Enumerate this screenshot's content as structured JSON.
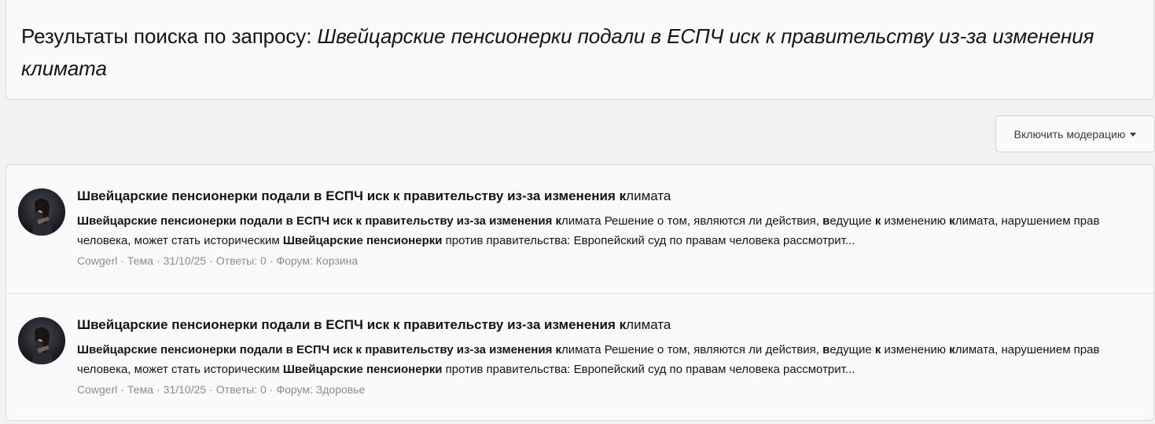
{
  "header": {
    "title_prefix": "Результаты поиска по запросу: ",
    "query": "Швейцарские пенсионерки подали в ЕСПЧ иск к правительству из-за изменения климата"
  },
  "toolbar": {
    "moderation_label": "Включить модерацию"
  },
  "results": [
    {
      "avatar": "user-avatar",
      "title_bold": "Швейцарские пенсионерки подали в ЕСПЧ иск к правительству из-за изменения к",
      "title_rest": "лимата",
      "snippet": {
        "b1": "Швейцарские пенсионерки подали в ЕСПЧ иск к правительству из-за изменения к",
        "t1": "лимата Решение о том, являются ли действия, ",
        "b2": "в",
        "t2": "едущие ",
        "b3": "к",
        "t3": " изменению ",
        "b4": "к",
        "t4": "лимата, нарушением прав человека, может стать историческим ",
        "b5": "Швейцарские пенсионерки",
        "t5": " против правительства: Европейский суд по правам человека рассмотрит..."
      },
      "meta": {
        "author": "Cowgerl",
        "type": "Тема",
        "date": "31/10/25",
        "replies": "Ответы: 0",
        "forum_prefix": "Форум: ",
        "forum": "Корзина"
      }
    },
    {
      "avatar": "user-avatar",
      "title_bold": "Швейцарские пенсионерки подали в ЕСПЧ иск к правительству из-за изменения к",
      "title_rest": "лимата",
      "snippet": {
        "b1": "Швейцарские пенсионерки подали в ЕСПЧ иск к правительству из-за изменения к",
        "t1": "лимата Решение о том, являются ли действия, ",
        "b2": "в",
        "t2": "едущие ",
        "b3": "к",
        "t3": " изменению ",
        "b4": "к",
        "t4": "лимата, нарушением прав человека, может стать историческим ",
        "b5": "Швейцарские пенсионерки",
        "t5": " против правительства: Европейский суд по правам человека рассмотрит..."
      },
      "meta": {
        "author": "Cowgerl",
        "type": "Тема",
        "date": "31/10/25",
        "replies": "Ответы: 0",
        "forum_prefix": "Форум: ",
        "forum": "Здоровье"
      }
    }
  ],
  "separator": "·"
}
